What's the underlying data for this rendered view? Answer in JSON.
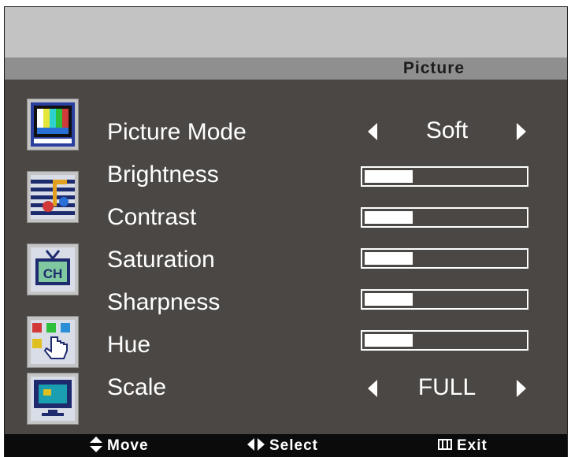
{
  "header": {
    "title": "Picture"
  },
  "sidebar": {
    "icons": [
      "picture-icon",
      "audio-icon",
      "channel-icon",
      "setup-icon",
      "screen-icon"
    ],
    "channel_icon_text": "CH"
  },
  "menu": {
    "picture_mode": {
      "label": "Picture  Mode",
      "value": "Soft"
    },
    "brightness": {
      "label": "Brightness",
      "level": 0.3
    },
    "contrast": {
      "label": "Contrast",
      "level": 0.3
    },
    "saturation": {
      "label": "Saturation",
      "level": 0.3
    },
    "sharpness": {
      "label": "Sharpness",
      "level": 0.3
    },
    "hue": {
      "label": "Hue",
      "level": 0.3
    },
    "scale": {
      "label": "Scale",
      "value": "FULL"
    }
  },
  "footer": {
    "move": "Move",
    "select": "Select",
    "exit": "Exit"
  },
  "colors": {
    "panel": "#4b4744",
    "header": "#8f8f8f",
    "top": "#c3c3c3",
    "footer": "#0b0b0b",
    "text": "#ffffff"
  }
}
